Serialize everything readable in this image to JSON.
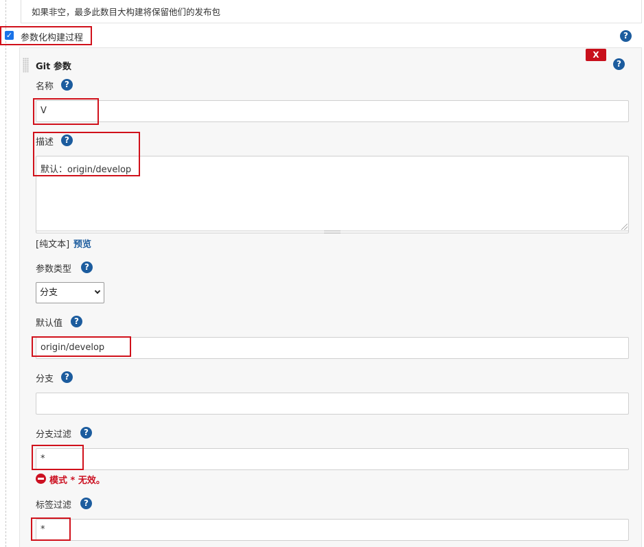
{
  "top_description": "如果非空，最多此数目大构建将保留他们的发布包",
  "parameterized": {
    "checked": true,
    "check_glyph": "✓",
    "label": "参数化构建过程"
  },
  "help_glyph": "?",
  "git_param": {
    "title": "Git 参数",
    "delete_label": "X",
    "name": {
      "label": "名称",
      "value": "V"
    },
    "description": {
      "label": "描述",
      "value": "默认：origin/develop",
      "format_prefix": "[纯文本]",
      "preview_link": "预览"
    },
    "param_type": {
      "label": "参数类型",
      "selected": "分支"
    },
    "default_value": {
      "label": "默认值",
      "value": "origin/develop"
    },
    "branch": {
      "label": "分支",
      "value": ""
    },
    "branch_filter": {
      "label": "分支过滤",
      "value": "*",
      "error": "模式 * 无效。"
    },
    "tag_filter": {
      "label": "标签过滤",
      "value": "*"
    }
  },
  "colors": {
    "help_icon": "#1c5c9e",
    "highlight_box": "#d0101a",
    "error": "#cc1122",
    "delete_button": "#c8101c"
  }
}
